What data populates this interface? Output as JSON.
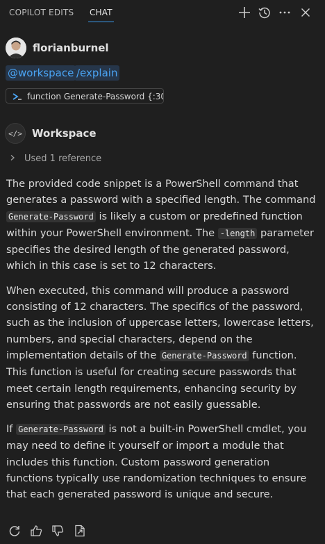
{
  "header": {
    "tabs": [
      {
        "label": "COPILOT EDITS"
      },
      {
        "label": "CHAT"
      }
    ],
    "icons": [
      "plus-icon",
      "history-icon",
      "more-icon",
      "close-icon"
    ]
  },
  "user": {
    "name": "florianburnel"
  },
  "chips": {
    "workspace": "@workspace",
    "explain": "/explain"
  },
  "reference_chip": {
    "label": "function Generate-Password {:30"
  },
  "participant": {
    "name": "Workspace"
  },
  "references": {
    "label": "Used 1 reference"
  },
  "message": {
    "p1_a": "The provided code snippet is a PowerShell command that generates a password with a specified length. The command ",
    "p1_code1": "Generate-Password",
    "p1_b": " is likely a custom or predefined function within your PowerShell environment. The ",
    "p1_code2": "-length",
    "p1_c": " parameter specifies the desired length of the generated password, which in this case is set to 12 characters.",
    "p2_a": "When executed, this command will produce a password consisting of 12 characters. The specifics of the password, such as the inclusion of uppercase letters, lowercase letters, numbers, and special characters, depend on the implementation details of the ",
    "p2_code1": "Generate-Password",
    "p2_b": " function. This function is useful for creating secure passwords that meet certain length requirements, enhancing security by ensuring that passwords are not easily guessable.",
    "p3_a": "If ",
    "p3_code1": "Generate-Password",
    "p3_b": " is not a built-in PowerShell cmdlet, you may need to define it yourself or import a module that includes this function. Custom password generation functions typically use randomization techniques to ensure that each generated password is unique and secure."
  },
  "footer": {
    "icons": [
      "retry-icon",
      "thumbs-up-icon",
      "thumbs-down-icon",
      "insert-into-new-file-icon"
    ]
  },
  "colors": {
    "background": "#1f1f1f",
    "accent": "#3b9ff3",
    "chip_background": "#26364a",
    "chip_text": "#4aa3f2"
  }
}
